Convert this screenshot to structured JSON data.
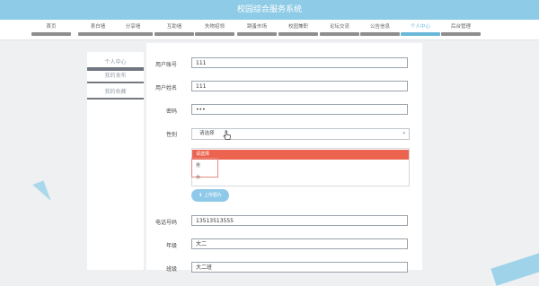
{
  "header": {
    "title": "校园综合服务系统"
  },
  "nav": {
    "items": [
      {
        "label": "首页"
      },
      {
        "label": "表白墙"
      },
      {
        "label": "分享墙"
      },
      {
        "label": "互助墙"
      },
      {
        "label": "失物招领"
      },
      {
        "label": "跳蚤市场"
      },
      {
        "label": "校园兼职"
      },
      {
        "label": "论坛交流"
      },
      {
        "label": "公告信息"
      },
      {
        "label": "个人中心"
      },
      {
        "label": "后台管理"
      }
    ],
    "active_index": 9
  },
  "sidebar": {
    "title": "个人中心",
    "items": [
      {
        "label": "我的发布"
      },
      {
        "label": "我的收藏"
      }
    ]
  },
  "form": {
    "account": {
      "label": "用户账号",
      "value": "111"
    },
    "name": {
      "label": "用户姓名",
      "value": "111"
    },
    "password": {
      "label": "密码",
      "value": "•••"
    },
    "gender": {
      "label": "性别",
      "placeholder": "请选择",
      "options": [
        "请选择",
        "男",
        "女"
      ],
      "selected_index": 0
    },
    "upload_label": "上传图片",
    "phone": {
      "label": "电话号码",
      "value": "13513513555"
    },
    "grade": {
      "label": "年级",
      "value": "大二"
    },
    "class": {
      "label": "班级",
      "value": "大二班"
    }
  },
  "colors": {
    "header_bg": "#8ecbe6",
    "accent": "#6ab8d8",
    "dropdown_selected": "#ec6450",
    "button": "#8fc9ea"
  },
  "icons": {
    "caret": "chevron-down-icon",
    "cursor": "hand-pointer-icon",
    "upload": "upload-icon"
  }
}
